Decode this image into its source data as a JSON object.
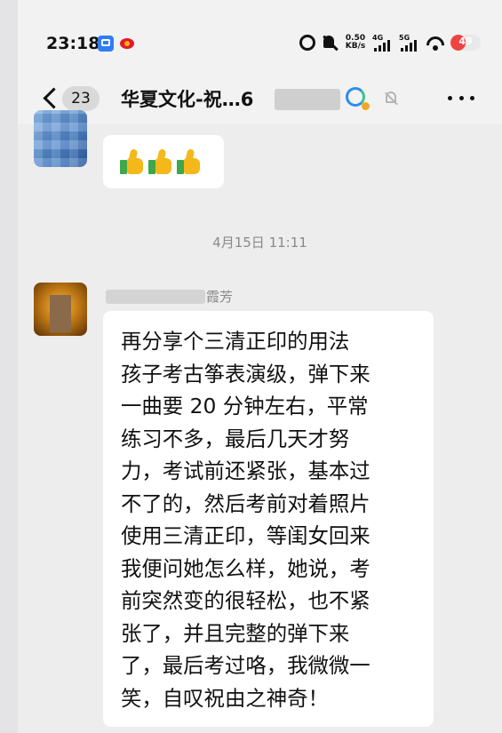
{
  "status_bar": {
    "time": "23:18",
    "net_speed_value": "0.50",
    "net_speed_unit": "KB/s",
    "signal1_label": "4G",
    "signal2_label": "5G",
    "battery_percent": "49",
    "battery_level": 0.49,
    "battery_color": "#ef4444"
  },
  "nav": {
    "unread_count": "23",
    "title": "华夏文化-祝…6"
  },
  "messages": {
    "timestamp": "4月15日 11:11",
    "sender_name_visible": "霞芳",
    "text": "再分享个三清正印的用法\n孩子考古筝表演级，弹下来\n一曲要 20 分钟左右，平常\n练习不多，最后几天才努\n力，考试前还紧张，基本过\n不了的，然后考前对着照片\n使用三清正印，等闺女回来\n我便问她怎么样，她说，考\n前突然变的很轻松，也不紧\n张了，并且完整的弹下来\n了，最后考过咯，我微微一\n笑，自叹祝由之神奇！"
  }
}
